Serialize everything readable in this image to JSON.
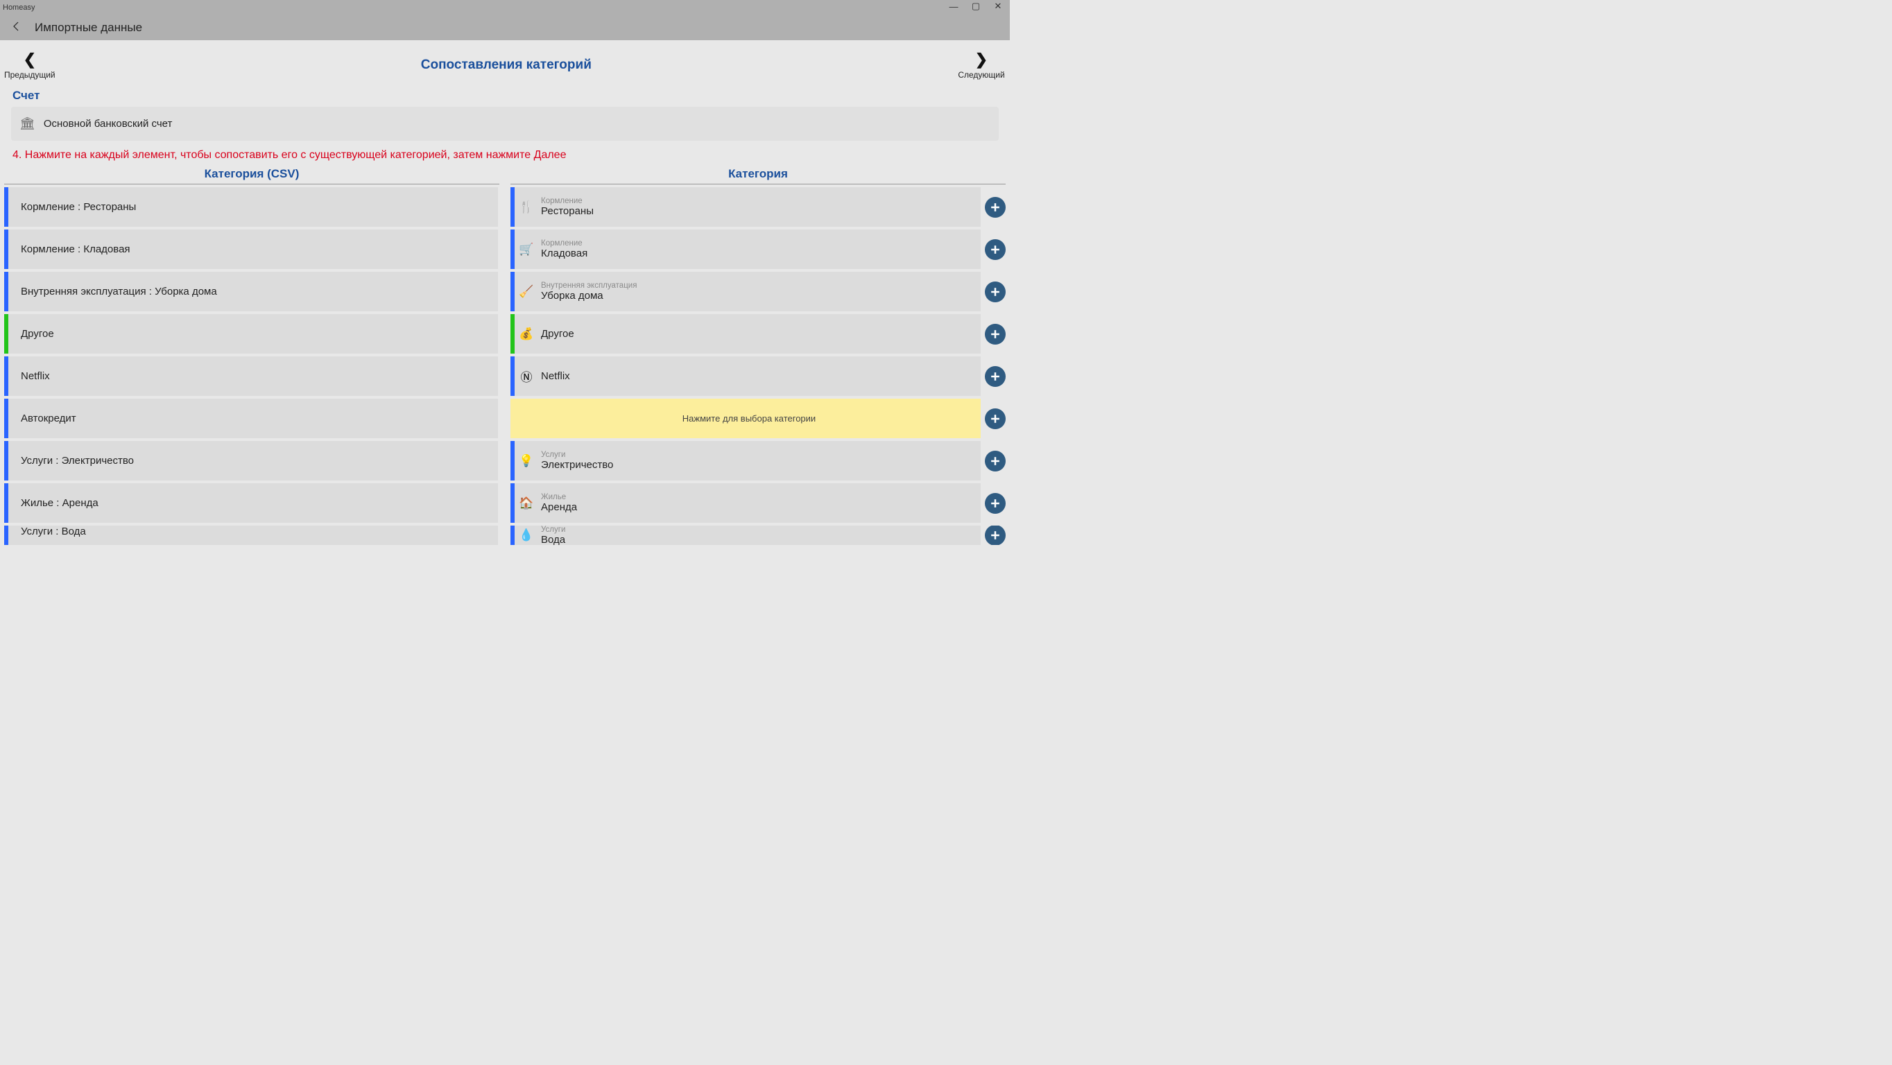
{
  "window": {
    "app_title": "Homeasy"
  },
  "header": {
    "title": "Импортные данные"
  },
  "nav": {
    "prev_label": "Предыдущий",
    "next_label": "Следующий",
    "page_title": "Сопоставления категорий"
  },
  "account": {
    "section_label": "Счет",
    "name": "Основной банковский счет"
  },
  "instruction": "4. Нажмите на каждый элемент, чтобы сопоставить его с существующей категорией, затем нажмите Далее",
  "left_col": {
    "header": "Категория (CSV)",
    "items": [
      {
        "label": "Кормление : Рестораны",
        "color": "blue"
      },
      {
        "label": "Кормление : Кладовая",
        "color": "blue"
      },
      {
        "label": "Внутренняя эксплуатация : Уборка дома",
        "color": "blue"
      },
      {
        "label": "Другое",
        "color": "green"
      },
      {
        "label": "Netflix",
        "color": "blue"
      },
      {
        "label": "Автокредит",
        "color": "blue"
      },
      {
        "label": "Услуги : Электричество",
        "color": "blue"
      },
      {
        "label": "Жилье : Аренда",
        "color": "blue"
      },
      {
        "label": "Услуги : Вода",
        "color": "blue"
      }
    ]
  },
  "right_col": {
    "header": "Категория",
    "items": [
      {
        "group": "Кормление",
        "name": "Рестораны",
        "icon": "🍴",
        "color": "blue"
      },
      {
        "group": "Кормление",
        "name": "Кладовая",
        "icon": "🛒",
        "color": "blue"
      },
      {
        "group": "Внутренняя эксплуатация",
        "name": "Уборка дома",
        "icon": "🧹",
        "color": "blue"
      },
      {
        "group": "",
        "name": "Другое",
        "icon": "💰",
        "color": "green"
      },
      {
        "group": "",
        "name": "Netflix",
        "icon": "Ⓝ",
        "color": "blue"
      },
      {
        "highlight": true,
        "text": "Нажмите для выбора категории"
      },
      {
        "group": "Услуги",
        "name": "Электричество",
        "icon": "💡",
        "color": "blue"
      },
      {
        "group": "Жилье",
        "name": "Аренда",
        "icon": "🏠",
        "color": "blue"
      },
      {
        "group": "Услуги",
        "name": "Вода",
        "icon": "💧",
        "color": "blue"
      }
    ]
  }
}
